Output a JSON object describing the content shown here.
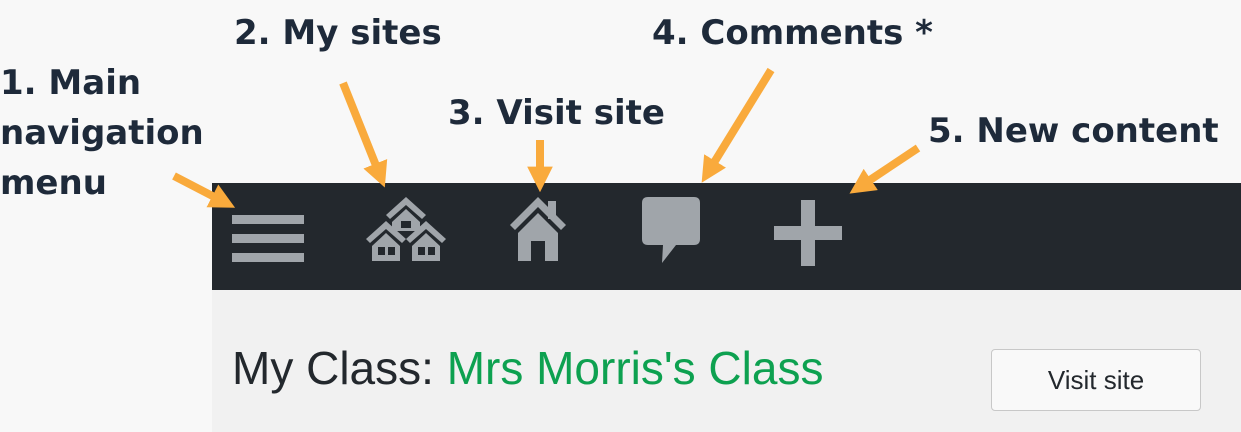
{
  "callouts": {
    "main_menu": "1. Main navigation menu",
    "my_sites": "2. My sites",
    "visit_site": "3. Visit site",
    "comments": "4. Comments *",
    "new_content": "5. New content"
  },
  "admin_bar": {
    "icons": [
      "menu-icon",
      "my-sites-icon",
      "home-icon",
      "comment-icon",
      "plus-icon"
    ]
  },
  "page": {
    "title_prefix": "My Class: ",
    "site_name": "Mrs Morris's Class",
    "visit_button": "Visit site"
  },
  "colors": {
    "callout_text": "#1e2a3a",
    "arrow": "#f9aa3c",
    "admin_bar_bg": "#23282d",
    "icon_gray": "#a0a5aa",
    "site_name": "#0da150"
  }
}
